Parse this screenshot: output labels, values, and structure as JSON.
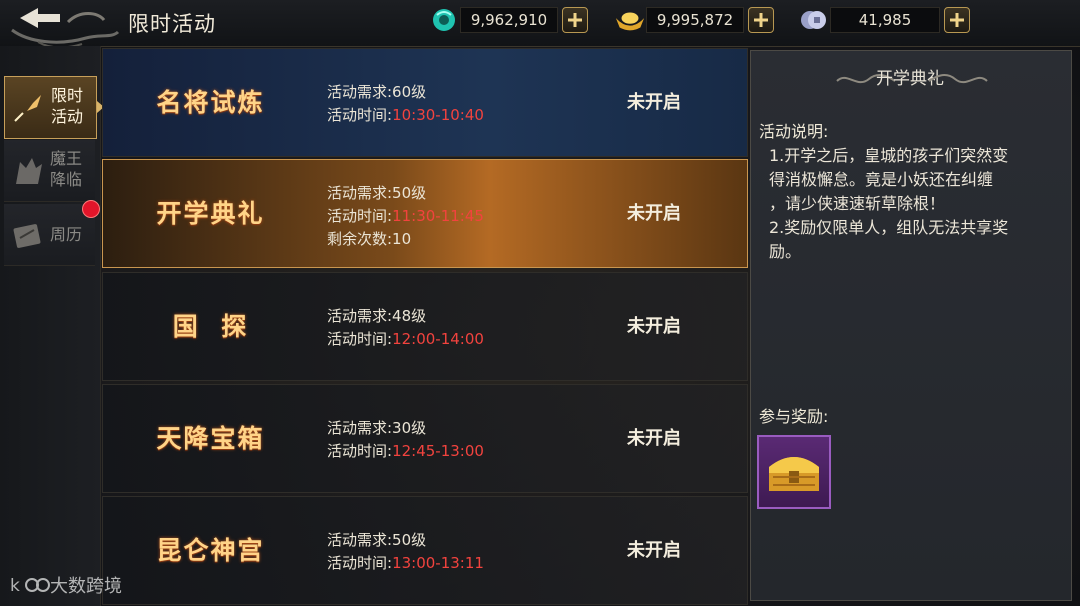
{
  "header": {
    "title": "限时活动",
    "currencies": [
      {
        "icon": "jade-icon",
        "value": "9,962,910"
      },
      {
        "icon": "gold-ingot-icon",
        "value": "9,995,872"
      },
      {
        "icon": "silver-coin-icon",
        "value": "41,985"
      }
    ]
  },
  "sidebar": {
    "items": [
      {
        "label": "限时\n活动",
        "icon": "quill-icon",
        "active": true
      },
      {
        "label": "魔王\n降临",
        "icon": "demon-icon",
        "active": false
      },
      {
        "label": "周历",
        "icon": "calendar-scroll-icon",
        "active": false,
        "badge": "red-dot"
      }
    ]
  },
  "activities": [
    {
      "name": "名将试炼",
      "req": "活动需求:60级",
      "time_label": "活动时间:",
      "time": "10:30-10:40",
      "status": "未开启"
    },
    {
      "name": "开学典礼",
      "req": "活动需求:50级",
      "time_label": "活动时间:",
      "time": "11:30-11:45",
      "extra": "剩余次数:10",
      "status": "未开启",
      "selected": true
    },
    {
      "name": "国  探",
      "req": "活动需求:48级",
      "time_label": "活动时间:",
      "time": "12:00-14:00",
      "status": "未开启"
    },
    {
      "name": "天降宝箱",
      "req": "活动需求:30级",
      "time_label": "活动时间:",
      "time": "12:45-13:00",
      "status": "未开启"
    },
    {
      "name": "昆仑神宫",
      "req": "活动需求:50级",
      "time_label": "活动时间:",
      "time": "13:00-13:11",
      "status": "未开启"
    }
  ],
  "detail": {
    "title": "开学典礼",
    "desc_label": "活动说明:",
    "desc_lines": [
      "1.开学之后，皇城的孩子们突然变",
      "得消极懈怠。竟是小妖还在纠缠",
      "，请少侠速速斩草除根！",
      "2.奖励仅限单人，组队无法共享奖",
      "励。"
    ],
    "reward_label": "参与奖励:",
    "reward_icon": "treasure-chest-icon"
  },
  "watermark": "大数跨境",
  "colors": {
    "time_red": "#f2433e",
    "gold_text": "#ffd488",
    "selected_row": "#b46a24"
  }
}
